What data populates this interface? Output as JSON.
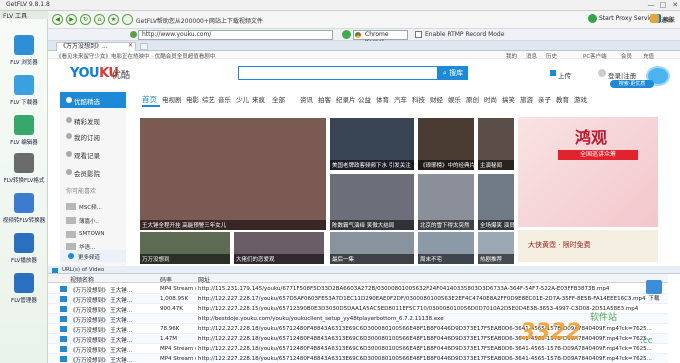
{
  "app": {
    "title": "GetFLV 9.8.1.8",
    "window_controls": [
      "—",
      "□",
      "✕"
    ]
  },
  "sidebar": {
    "header": "FLV 工具",
    "items": [
      {
        "label": "FLV 浏览器",
        "icon": "globe-icon",
        "color": "#2f8fd6"
      },
      {
        "label": "FLV 下载器",
        "icon": "download-icon",
        "color": "#3aa0e0"
      },
      {
        "label": "FLV 编辑器",
        "icon": "film-edit-icon",
        "color": "#37a86b"
      },
      {
        "label": "FLV转换FLV格式",
        "icon": "swap-icon",
        "color": "#6b6b6b"
      },
      {
        "label": "视频转FLV转换器",
        "icon": "convert-icon",
        "color": "#3c7bcf"
      },
      {
        "label": "FLV播放器",
        "icon": "play-icon",
        "color": "#2a6fc0"
      },
      {
        "label": "FLV管理器",
        "icon": "manager-icon",
        "color": "#2a6fc0"
      }
    ]
  },
  "toolbar": {
    "notice": "GetFLV帮助您从200000+网站上下载视频文件",
    "nav_glyphs": [
      "◀",
      "▶",
      "↻",
      "⌂",
      "★"
    ],
    "proxy_label": "Start Proxy Service",
    "exit_label": "退出",
    "skin_label": "换肤"
  },
  "address": {
    "url": "http://www.youku.com/",
    "kernel": "Chrome Kernel",
    "rtmp_label": "Enable RTMP Record Mode"
  },
  "tabs": [
    {
      "label": "《万万没想到》..."
    }
  ],
  "youku": {
    "topbar_notice": "《看见未来留守少女》电影正在热映中 · 优酷会员全员超值看剧中",
    "top_links": [
      "我的",
      "消息",
      "历史",
      "PC客户端",
      "会员",
      "充值"
    ],
    "logo_en_a": "YOU",
    "logo_en_b": "KU",
    "logo_cn": "优酷",
    "search_button": "搜库",
    "upload": "上传",
    "login": "登录|注册",
    "bubble_tag": "搜索·更优质",
    "nav": [
      {
        "label": "优酷精选",
        "active": true
      },
      {
        "label": "精彩发现"
      },
      {
        "label": "我的订阅"
      },
      {
        "label": "观看记录"
      },
      {
        "label": "会员影院"
      }
    ],
    "nav_recent_title": "你可能喜欢",
    "nav_recent": [
      "MSC频...",
      "薄嘉小..",
      "SMTOWN",
      "华语..."
    ],
    "nav_more": "更多频道",
    "categories": [
      "首页",
      "电视剧",
      "电影",
      "综艺",
      "音乐",
      "少儿",
      "来疯",
      "全部",
      "资讯",
      "拍客",
      "纪录片",
      "公益",
      "体育",
      "汽车",
      "科技",
      "财经",
      "娱乐",
      "原创",
      "时尚",
      "搞笑",
      "旅游",
      "亲子",
      "教育",
      "游戏"
    ],
    "videos": [
      {
        "caption": "王大锤全程开挂 高能预警三年女儿",
        "color": "#7a5a52"
      },
      {
        "caption": "美国老牌政客频频下水 引发关注",
        "color": "#394455"
      },
      {
        "caption": "《琅琊榜》中的经典片段",
        "color": "#4a3b33"
      },
      {
        "caption": "主演秘闻",
        "color": "#5b4e48"
      },
      {
        "caption": "陈数霸气演绎 笑傲大结局",
        "color": "#6c6f7a"
      },
      {
        "caption": "北京的雪下得太突然",
        "color": "#8a8f99"
      },
      {
        "caption": "全场爆笑 演员集体NG",
        "color": "#707a86"
      },
      {
        "caption": "万万没想到",
        "color": "#5d6b52"
      },
      {
        "caption": "大佬们的恋爱观",
        "color": "#6b5d66"
      },
      {
        "caption": "最后一集",
        "color": "#89939e"
      },
      {
        "caption": "周末不宅",
        "color": "#8c9aa8"
      },
      {
        "caption": "热剧推荐",
        "color": "#9ba7b3"
      }
    ],
    "banner_title": "鸿观",
    "banner_sub": "全国巡讲众筹",
    "banner_bottom": "大侠黄霑 · 限时免费"
  },
  "video_table": {
    "header": "URL(s) of Video",
    "columns": [
      "视频名称",
      "码率",
      "网址"
    ],
    "rows": [
      {
        "name": "《万万没想到》 王大锤...",
        "rate": "MP4 Stream (4.2M)",
        "url": "http://115.231.179.145/youku/6771F508F5D33D2BA6603A272B/03000801005632F24F04140335803D3D6733A-364F-54F7-522A-E03FFB3873B.mp4"
      },
      {
        "name": "《万万没想到》 王大锤...",
        "rate": "1,008.95K",
        "url": "http://122.227.228.17/youku/657D5AF0603FE53A7D1EC11D290EAE0F2DF/0300080100563E2EF4C4740E8A2FF0D9E8EC01E-2D7A-35FF-8E5B-FA14EEE16C3.mp4"
      },
      {
        "name": "《万万没想到》 王大锤...",
        "rate": "900.47K",
        "url": "http://122.227.228.15/youku/65712390B0E3D3030D5DAA1A5AC5ED8011EF5C710/030008010056D0D7010A2D5E0D4E3B-3653-4997-C3D08-2D51A58E3.mp4"
      },
      {
        "name": "《万万没想到》 王大锤...",
        "rate": "",
        "url": "http://bestdoje.youku.com/youku/youkuclient_setup_yy48tplayerbottom_6.7.2.11138.exe"
      },
      {
        "name": "《万万没想到》 王大锤...",
        "rate": "78.96K",
        "url": "http://122.227.228.18/youku/65712480F48843A6313E69C6D300080100566E48F1B8F0446D9D373E17F5EAB0D6-3641-4565-157B-D09A7840409F.mp4?ck=7625..."
      },
      {
        "name": "《万万没想到》 王大锤...",
        "rate": "1.47M",
        "url": "http://122.227.228.18/youku/65712480F48843A6313E69C6D300080100566E48F1B8F0446D9D373E17F5EAB0D6-3641-4565-157B-D09A7840409F.mp4?ck=7625..."
      },
      {
        "name": "《万万没想到》 王大锤...",
        "rate": "MP4 Stream (4.24M)",
        "url": "http://122.227.228.18/youku/65712480F48843A6313E69C6D300080100566E48F1B8F0446D9D373E17F5EAB0D6-3641-4565-157B-D09A7840409F.mp4?ck=7625..."
      },
      {
        "name": "《万万没想到》 王大锤...",
        "rate": "MP4 Stream (4.24M)",
        "url": "http://122.227.228.18/youku/65712480F48843A6313E69C6D300080100566E48F1B8F0446D9D373E17F5EAB0D6-3641-4565-157B-D09A7840409F.mp4?ck=7625..."
      }
    ],
    "download_label": "下载"
  },
  "watermark": {
    "main": "3322",
    "sub": "软件站",
    "cc": ".cc"
  }
}
